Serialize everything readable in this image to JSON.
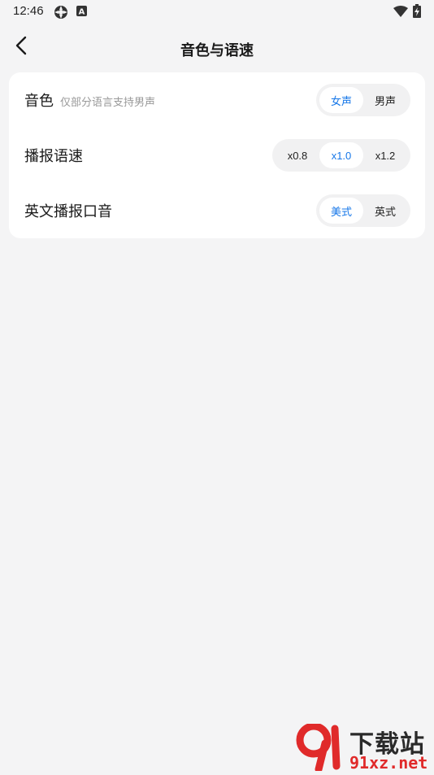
{
  "status_bar": {
    "time": "12:46",
    "icons": [
      "sync-icon",
      "notification-a-icon",
      "wifi-icon",
      "battery-charging-icon"
    ],
    "notification_letter": "A"
  },
  "header": {
    "title": "音色与语速",
    "back_icon": "chevron-left-icon"
  },
  "settings": {
    "voice": {
      "label": "音色",
      "hint": "仅部分语言支持男声",
      "options": [
        "女声",
        "男声"
      ],
      "selected": "女声"
    },
    "speed": {
      "label": "播报语速",
      "options": [
        "x0.8",
        "x1.0",
        "x1.2"
      ],
      "selected": "x1.0"
    },
    "accent": {
      "label": "英文播报口音",
      "options": [
        "美式",
        "英式"
      ],
      "selected": "美式"
    }
  },
  "colors": {
    "accent": "#1677e8",
    "background": "#f4f4f5",
    "card": "#ffffff",
    "segment_track": "#f1f1f2"
  },
  "watermark": {
    "brand": "下载站",
    "url": "91xz.net"
  }
}
